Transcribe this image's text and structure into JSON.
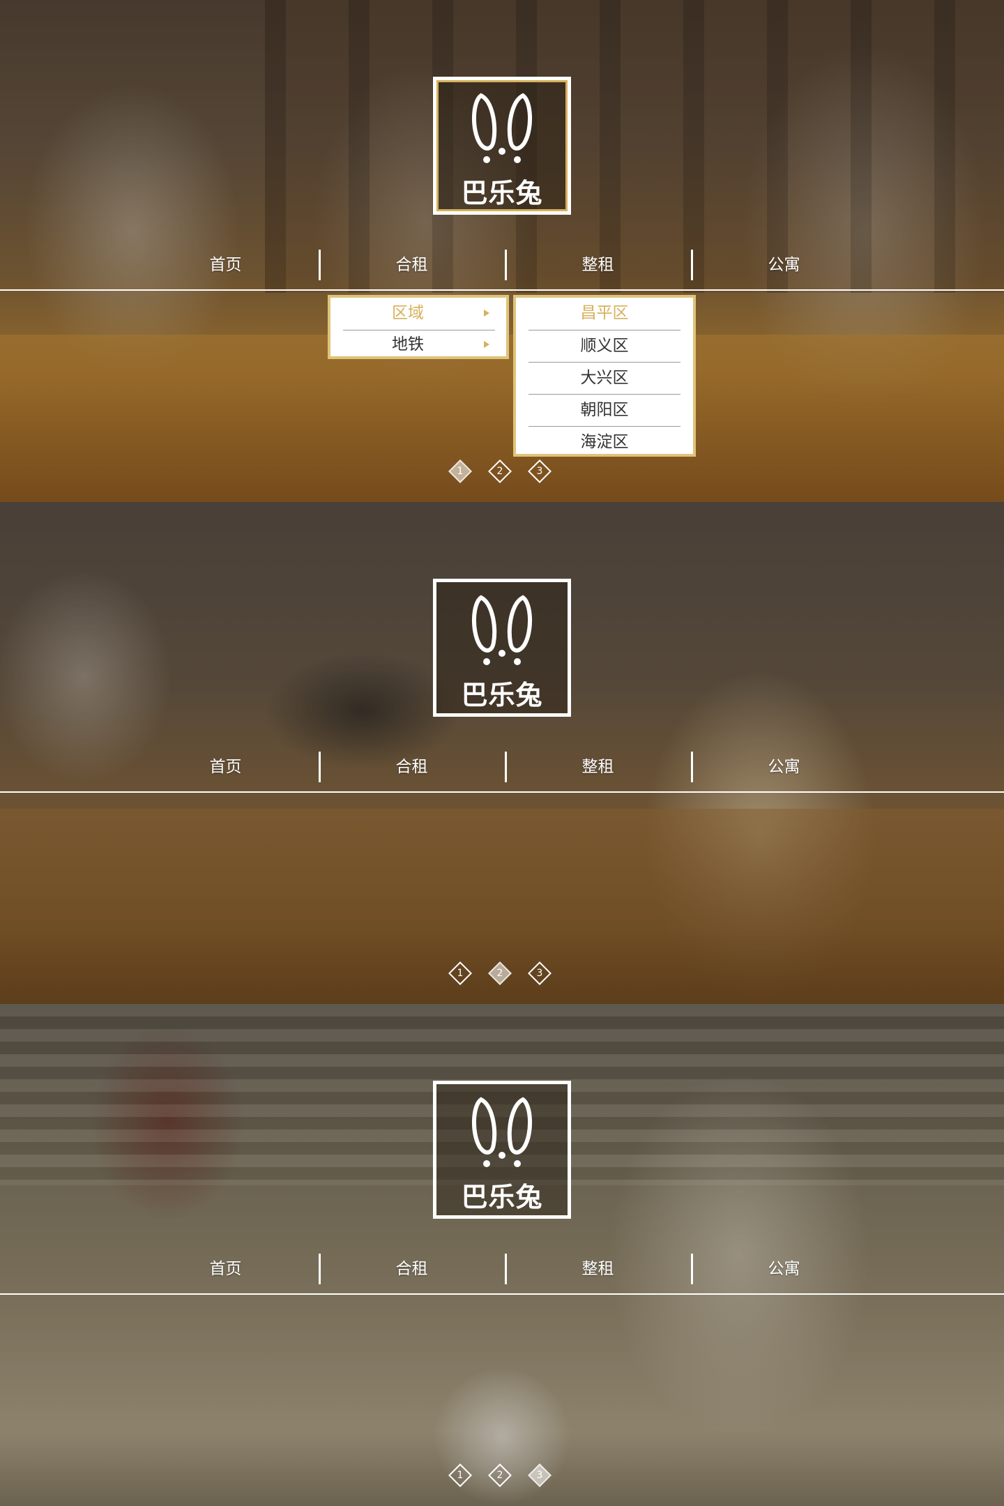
{
  "brand": {
    "name": "巴乐兔",
    "logo_icon": "rabbit-ears-icon",
    "accent_color": "#d6b15c"
  },
  "nav": {
    "items": [
      "首页",
      "合租",
      "整租",
      "公寓"
    ]
  },
  "carousel": {
    "pages": [
      "1",
      "2",
      "3"
    ]
  },
  "panels": [
    {
      "active_page": 1
    },
    {
      "active_page": 2
    },
    {
      "active_page": 3
    }
  ],
  "dropdown": {
    "primary": [
      {
        "label": "区域",
        "icon": "caret-right-icon"
      },
      {
        "label": "地铁",
        "icon": "caret-right-icon"
      }
    ],
    "districts": [
      "昌平区",
      "顺义区",
      "大兴区",
      "朝阳区",
      "海淀区"
    ]
  }
}
